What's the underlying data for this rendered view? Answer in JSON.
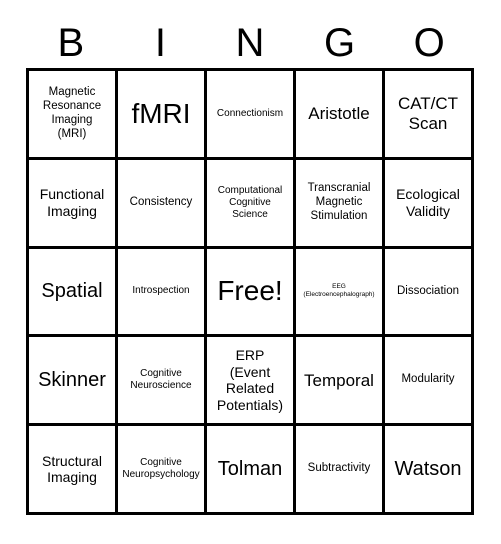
{
  "card": {
    "title_letters": [
      "B",
      "I",
      "N",
      "G",
      "O"
    ],
    "border_color": "#000000",
    "background_color": "#ffffff",
    "text_color": "#000000",
    "columns": 5,
    "rows": 5
  },
  "cells": [
    {
      "text": "Magnetic\nResonance\nImaging\n(MRI)",
      "size": "sm",
      "free": false
    },
    {
      "text": "fMRI",
      "size": "xxl",
      "free": false
    },
    {
      "text": "Connectionism",
      "size": "xs",
      "free": false
    },
    {
      "text": "Aristotle",
      "size": "lg",
      "free": false
    },
    {
      "text": "CAT/CT\nScan",
      "size": "lg",
      "free": false
    },
    {
      "text": "Functional\nImaging",
      "size": "md",
      "free": false
    },
    {
      "text": "Consistency",
      "size": "sm",
      "free": false
    },
    {
      "text": "Computational\nCognitive\nScience",
      "size": "xs",
      "free": false
    },
    {
      "text": "Transcranial\nMagnetic\nStimulation",
      "size": "sm",
      "free": false
    },
    {
      "text": "Ecological\nValidity",
      "size": "md",
      "free": false
    },
    {
      "text": "Spatial",
      "size": "xl",
      "free": false
    },
    {
      "text": "Introspection",
      "size": "xs",
      "free": false
    },
    {
      "text": "Free!",
      "size": "xxl",
      "free": true
    },
    {
      "text": "EEG\n(Electroencephalograph)",
      "size": "xxs",
      "free": false
    },
    {
      "text": "Dissociation",
      "size": "sm",
      "free": false
    },
    {
      "text": "Skinner",
      "size": "xl",
      "free": false
    },
    {
      "text": "Cognitive\nNeuroscience",
      "size": "xs",
      "free": false
    },
    {
      "text": "ERP\n(Event\nRelated\nPotentials)",
      "size": "md",
      "free": false
    },
    {
      "text": "Temporal",
      "size": "lg",
      "free": false
    },
    {
      "text": "Modularity",
      "size": "sm",
      "free": false
    },
    {
      "text": "Structural\nImaging",
      "size": "md",
      "free": false
    },
    {
      "text": "Cognitive\nNeuropsychology",
      "size": "xs",
      "free": false
    },
    {
      "text": "Tolman",
      "size": "xl",
      "free": false
    },
    {
      "text": "Subtractivity",
      "size": "sm",
      "free": false
    },
    {
      "text": "Watson",
      "size": "xl",
      "free": false
    }
  ]
}
